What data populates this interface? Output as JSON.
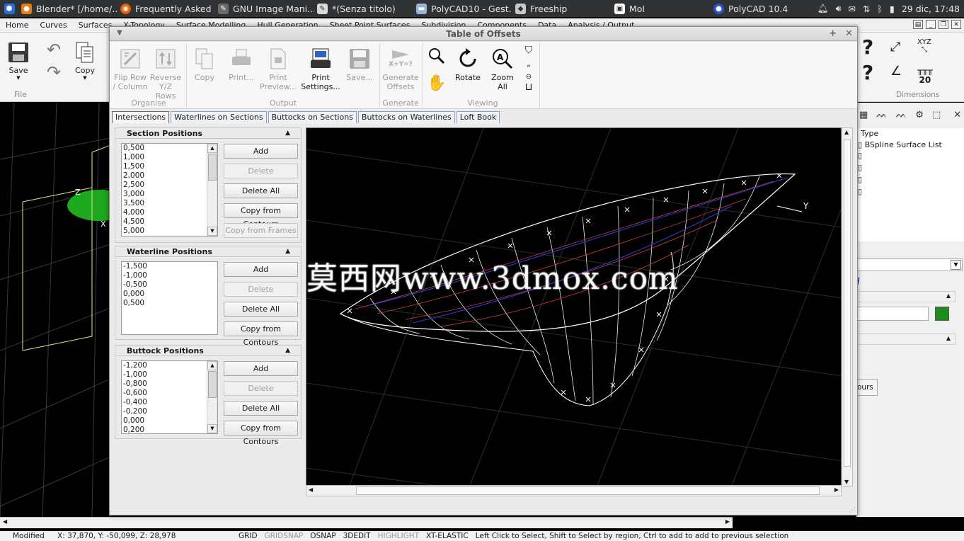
{
  "taskbar": {
    "items": [
      {
        "label": "Blender* [/home/...",
        "icon": "blender-icon",
        "color": "#e87d0d"
      },
      {
        "label": "Frequently Asked ...",
        "icon": "firefox-icon",
        "color": "#e66000"
      },
      {
        "label": "GNU Image Mani...",
        "icon": "gimp-icon",
        "color": "#6b6b6b"
      },
      {
        "label": "*(Senza titolo)",
        "icon": "text-editor-icon",
        "color": "#d9d9d9"
      },
      {
        "label": "PolyCAD10 - Gest...",
        "icon": "folder-icon",
        "color": "#9ab4d8"
      },
      {
        "label": "Freeship",
        "icon": "freeship-icon",
        "color": "#c8c8c8"
      },
      {
        "label": "MoI",
        "icon": "moi-icon",
        "color": "#ffffff"
      },
      {
        "label": "PolyCAD 10.4",
        "icon": "polycad-icon",
        "color": "#2b52c8"
      }
    ],
    "clock": "29 dic, 17:48"
  },
  "menubar": {
    "items": [
      "Home",
      "Curves",
      "Surfaces",
      "X-Topology",
      "Surface Modelling",
      "Hull Generation",
      "Sheet Point Surfaces",
      "Subdivision",
      "Components",
      "Data",
      "Analysis / Output"
    ]
  },
  "bg_ribbon": {
    "save_label": "Save",
    "copy_label": "Copy",
    "file_group": "File",
    "dimensions_group": "Dimensions",
    "scale_value": "20"
  },
  "dialog": {
    "title": "Table of Offsets",
    "ribbon": {
      "buttons": {
        "flip": "Flip Row / Column",
        "reverse": "Reverse Y/Z Rows",
        "copy": "Copy",
        "print": "Print...",
        "print_preview": "Print Preview...",
        "print_settings": "Print Settings...",
        "save": "Save...",
        "generate": "Generate Offsets",
        "generate_icon_text": "X+Y=?",
        "rotate": "Rotate",
        "zoom_all": "Zoom All"
      },
      "groups": {
        "organise": "Organise",
        "output": "Output",
        "generate": "Generate",
        "viewing": "Viewing"
      }
    },
    "tabs": [
      "Intersections",
      "Waterlines on Sections",
      "Buttocks on Sections",
      "Buttocks on Waterlines",
      "Loft Book"
    ],
    "sections": {
      "title": "Section Positions",
      "values": [
        "0,500",
        "1,000",
        "1,500",
        "2,000",
        "2,500",
        "3,000",
        "3,500",
        "4,000",
        "4,500",
        "5,000"
      ],
      "buttons": {
        "add": "Add",
        "delete": "Delete",
        "delete_all": "Delete All",
        "copy_contours": "Copy from Contours",
        "copy_frames": "Copy from Frames"
      }
    },
    "waterlines": {
      "title": "Waterline Positions",
      "values": [
        "-1,500",
        "-1,000",
        "-0,500",
        "0,000",
        "0,500"
      ],
      "buttons": {
        "add": "Add",
        "delete": "Delete",
        "delete_all": "Delete All",
        "copy_contours": "Copy from Contours"
      }
    },
    "buttocks": {
      "title": "Buttock Positions",
      "values": [
        "-1,200",
        "-1,000",
        "-0,800",
        "-0,600",
        "-0,400",
        "-0,200",
        "0,000",
        "0,200"
      ],
      "buttons": {
        "add": "Add",
        "delete": "Delete",
        "delete_all": "Delete All",
        "copy_contours": "Copy from Contours"
      }
    },
    "view": {
      "axis_y": "Y",
      "watermark": "莫西网www.3dmox.com"
    }
  },
  "bg_left_viewport": {
    "axis_z": "Z",
    "axis_x": "X"
  },
  "right_panel": {
    "type_header": "Type",
    "tree_item": "BSpline Surface List",
    "button_partial": "ours",
    "accent_color": "#1e8c1e"
  },
  "statusbar": {
    "modified": "Modified",
    "coords": "X:  37,870, Y: -50,099, Z:  28,978",
    "grid": "GRID",
    "gridsnap": "GRIDSNAP",
    "osnap": "OSNAP",
    "edit3d": "3DEDIT",
    "highlight": "HIGHLIGHT",
    "xt_elastic": "XT-ELASTIC",
    "hint": "Left Click to Select, Shift to Select by region, Ctrl to add to add to previous selection"
  }
}
